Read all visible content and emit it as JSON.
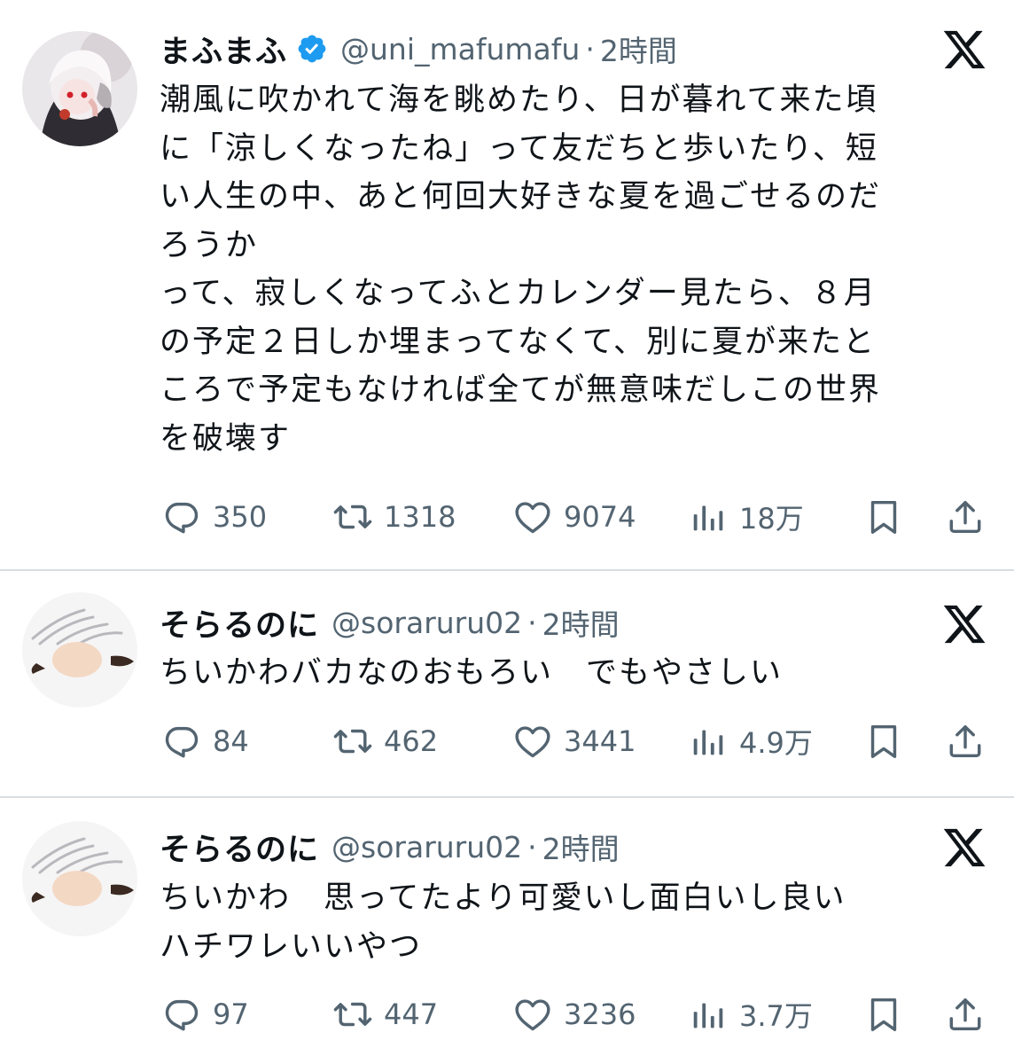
{
  "tweets": [
    {
      "name": "まふまふ",
      "handle": "@uni_mafumafu",
      "separator": "·",
      "time": "2時間",
      "lines": [
        "潮風に吹かれて海を眺めたり、日が暮れて来た頃",
        "に「涼しくなったね」って友だちと歩いたり、短",
        "い人生の中、あと何回大好きな夏を過ごせるのだ",
        "ろうか",
        "って、寂しくなってふとカレンダー見たら、８月",
        "の予定２日しか埋まってなくて、別に夏が来たと",
        "ころで予定もなければ全てが無意味だしこの世界",
        "を破壊す"
      ],
      "replies": "350",
      "retweets": "1318",
      "likes": "9074",
      "views": "18万"
    },
    {
      "name": "そらるのに",
      "handle": "@soraruru02",
      "separator": "·",
      "time": "2時間",
      "lines": [
        "ちいかわバカなのおもろい　でもやさしい"
      ],
      "replies": "84",
      "retweets": "462",
      "likes": "3441",
      "views": "4.9万"
    },
    {
      "name": "そらるのに",
      "handle": "@soraruru02",
      "separator": "·",
      "time": "2時間",
      "lines": [
        "ちいかわ　思ってたより可愛いし面白いし良い",
        "ハチワレいいやつ"
      ],
      "replies": "97",
      "retweets": "447",
      "likes": "3236",
      "views": "3.7万"
    }
  ],
  "icons": {
    "verified": "verified-badge-icon",
    "platform": "x-logo-icon",
    "reply": "reply-icon",
    "retweet": "retweet-icon",
    "like": "like-icon",
    "views": "views-icon",
    "bookmark": "bookmark-icon",
    "share": "share-icon"
  },
  "colors": {
    "verified": "#1d9bf0",
    "secondary_text": "#536471",
    "divider": "#d8dde1"
  }
}
